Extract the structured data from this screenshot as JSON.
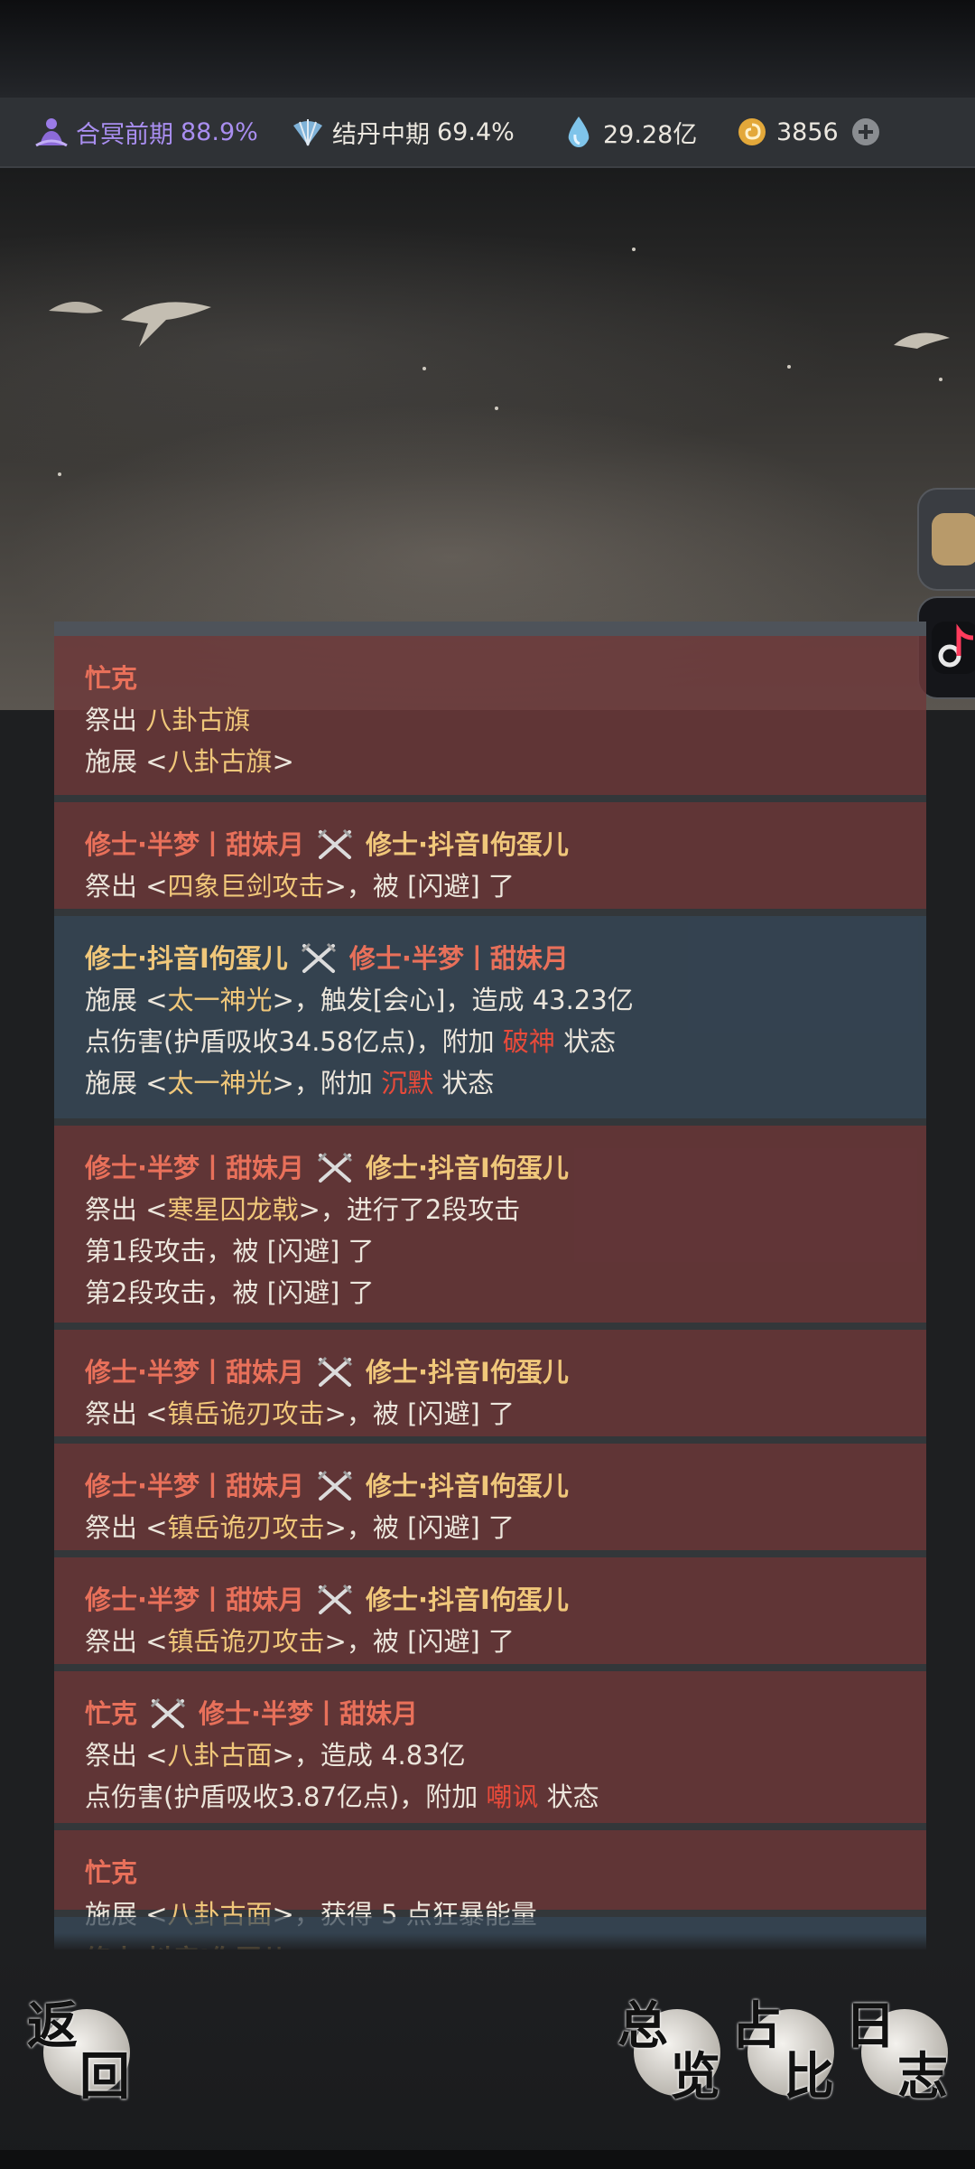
{
  "status_bar": {
    "realm1": {
      "name": "合冥前期",
      "pct": "88.9%",
      "icon": "lotus-figure-icon",
      "color": "#a98ef0"
    },
    "realm2": {
      "name": "结丹中期",
      "pct": "69.4%",
      "icon": "fan-icon",
      "color": "#e8e6e0"
    },
    "spirit": {
      "value": "29.28亿",
      "icon": "water-drop-icon"
    },
    "coins": {
      "value": "3856",
      "icon": "spiral-coin-icon"
    },
    "add_icon": "plus-circle-icon"
  },
  "log": [
    {
      "style": "red",
      "actor": "忙克",
      "target": "",
      "lines": [
        [
          {
            "t": "祭出 "
          },
          {
            "t": "八卦古旗",
            "c": "gold"
          }
        ],
        [
          {
            "t": "施展 <"
          },
          {
            "t": "八卦古旗",
            "c": "gold"
          },
          {
            "t": ">"
          }
        ]
      ]
    },
    {
      "style": "red",
      "actor": "修士·半梦丨甜妹月",
      "target": "修士·抖音I佝蛋儿",
      "lines": [
        [
          {
            "t": "祭出 <"
          },
          {
            "t": "四象巨剑攻击",
            "c": "gold"
          },
          {
            "t": ">，被 [闪避] 了"
          }
        ]
      ]
    },
    {
      "style": "blue",
      "actor": "修士·抖音I佝蛋儿",
      "target": "修士·半梦丨甜妹月",
      "lines": [
        [
          {
            "t": "施展 <"
          },
          {
            "t": "太一神光",
            "c": "gold"
          },
          {
            "t": ">，触发[会心]，造成 43.23亿"
          }
        ],
        [
          {
            "t": "点伤害(护盾吸收34.58亿点)，附加 "
          },
          {
            "t": "破神",
            "c": "status"
          },
          {
            "t": " 状态"
          }
        ],
        [
          {
            "t": "施展 <"
          },
          {
            "t": "太一神光",
            "c": "gold"
          },
          {
            "t": ">，附加 "
          },
          {
            "t": "沉默",
            "c": "status"
          },
          {
            "t": " 状态"
          }
        ]
      ]
    },
    {
      "style": "red",
      "actor": "修士·半梦丨甜妹月",
      "target": "修士·抖音I佝蛋儿",
      "lines": [
        [
          {
            "t": "祭出 <"
          },
          {
            "t": "寒星囚龙戟",
            "c": "gold"
          },
          {
            "t": ">，进行了2段攻击"
          }
        ],
        [
          {
            "t": "第1段攻击，被 [闪避] 了"
          }
        ],
        [
          {
            "t": "第2段攻击，被 [闪避] 了"
          }
        ]
      ]
    },
    {
      "style": "red",
      "actor": "修士·半梦丨甜妹月",
      "target": "修士·抖音I佝蛋儿",
      "lines": [
        [
          {
            "t": "祭出 <"
          },
          {
            "t": "镇岳诡刃攻击",
            "c": "gold"
          },
          {
            "t": ">，被 [闪避] 了"
          }
        ]
      ]
    },
    {
      "style": "red",
      "actor": "修士·半梦丨甜妹月",
      "target": "修士·抖音I佝蛋儿",
      "lines": [
        [
          {
            "t": "祭出 <"
          },
          {
            "t": "镇岳诡刃攻击",
            "c": "gold"
          },
          {
            "t": ">，被 [闪避] 了"
          }
        ]
      ]
    },
    {
      "style": "red",
      "actor": "修士·半梦丨甜妹月",
      "target": "修士·抖音I佝蛋儿",
      "lines": [
        [
          {
            "t": "祭出 <"
          },
          {
            "t": "镇岳诡刃攻击",
            "c": "gold"
          },
          {
            "t": ">，被 [闪避] 了"
          }
        ]
      ]
    },
    {
      "style": "red",
      "actor": "忙克",
      "target": "修士·半梦丨甜妹月",
      "lines": [
        [
          {
            "t": "祭出 <"
          },
          {
            "t": "八卦古面",
            "c": "gold"
          },
          {
            "t": ">，造成 4.83亿"
          }
        ],
        [
          {
            "t": "点伤害(护盾吸收3.87亿点)，附加 "
          },
          {
            "t": "嘲讽",
            "c": "status"
          },
          {
            "t": " 状态"
          }
        ]
      ]
    },
    {
      "style": "red",
      "actor": "忙克",
      "target": "",
      "lines": [
        [
          {
            "t": "施展 <"
          },
          {
            "t": "八卦古面",
            "c": "gold"
          },
          {
            "t": ">，获得 5 点狂暴能量"
          }
        ]
      ]
    },
    {
      "style": "blue",
      "actor": "修士·抖音I佝蛋儿",
      "target": "",
      "lines": []
    }
  ],
  "bottom_nav": {
    "back": {
      "c1": "返",
      "c2": "回"
    },
    "overview": {
      "c1": "总",
      "c2": "览"
    },
    "ratio": {
      "c1": "占",
      "c2": "比"
    },
    "log": {
      "c1": "日",
      "c2": "志"
    }
  },
  "colors": {
    "entry_red": "#7d3434",
    "entry_blue": "#344658",
    "gold": "#f0c77a",
    "status": "#e84a3a"
  }
}
